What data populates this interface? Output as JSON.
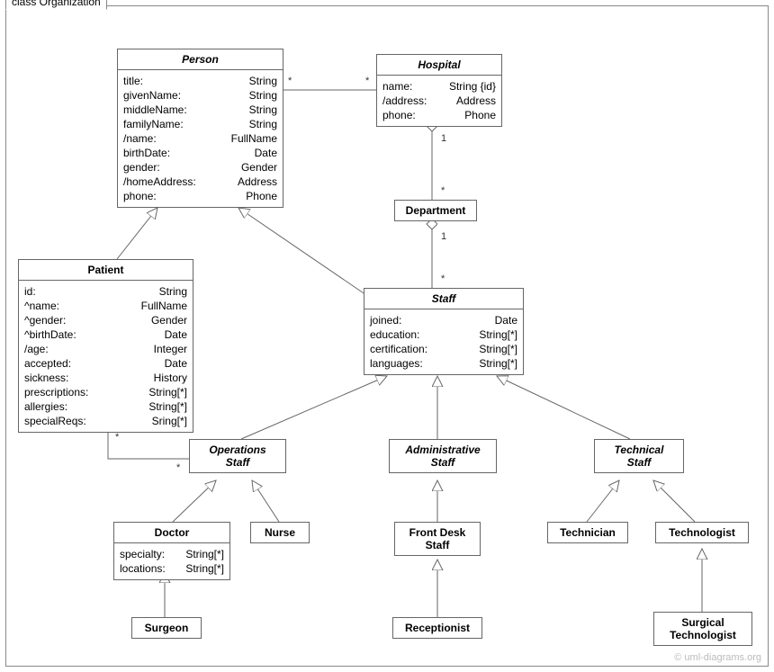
{
  "frameTitle": "class Organization",
  "watermark": "© uml-diagrams.org",
  "classes": {
    "person": {
      "name": "Person",
      "attrs": [
        {
          "k": "title:",
          "v": "String"
        },
        {
          "k": "givenName:",
          "v": "String"
        },
        {
          "k": "middleName:",
          "v": "String"
        },
        {
          "k": "familyName:",
          "v": "String"
        },
        {
          "k": "/name:",
          "v": "FullName"
        },
        {
          "k": "birthDate:",
          "v": "Date"
        },
        {
          "k": "gender:",
          "v": "Gender"
        },
        {
          "k": "/homeAddress:",
          "v": "Address"
        },
        {
          "k": "phone:",
          "v": "Phone"
        }
      ]
    },
    "hospital": {
      "name": "Hospital",
      "attrs": [
        {
          "k": "name:",
          "v": "String {id}"
        },
        {
          "k": "/address:",
          "v": "Address"
        },
        {
          "k": "phone:",
          "v": "Phone"
        }
      ]
    },
    "department": {
      "name": "Department"
    },
    "patient": {
      "name": "Patient",
      "attrs": [
        {
          "k": "id:",
          "v": "String"
        },
        {
          "k": "^name:",
          "v": "FullName"
        },
        {
          "k": "^gender:",
          "v": "Gender"
        },
        {
          "k": "^birthDate:",
          "v": "Date"
        },
        {
          "k": "/age:",
          "v": "Integer"
        },
        {
          "k": "accepted:",
          "v": "Date"
        },
        {
          "k": "sickness:",
          "v": "History"
        },
        {
          "k": "prescriptions:",
          "v": "String[*]"
        },
        {
          "k": "allergies:",
          "v": "String[*]"
        },
        {
          "k": "specialReqs:",
          "v": "Sring[*]"
        }
      ]
    },
    "staff": {
      "name": "Staff",
      "attrs": [
        {
          "k": "joined:",
          "v": "Date"
        },
        {
          "k": "education:",
          "v": "String[*]"
        },
        {
          "k": "certification:",
          "v": "String[*]"
        },
        {
          "k": "languages:",
          "v": "String[*]"
        }
      ]
    },
    "opsStaff": {
      "name": "Operations\nStaff"
    },
    "adminStaff": {
      "name": "Administrative\nStaff"
    },
    "techStaff": {
      "name": "Technical\nStaff"
    },
    "doctor": {
      "name": "Doctor",
      "attrs": [
        {
          "k": "specialty:",
          "v": "String[*]"
        },
        {
          "k": "locations:",
          "v": "String[*]"
        }
      ]
    },
    "nurse": {
      "name": "Nurse"
    },
    "frontDesk": {
      "name": "Front Desk\nStaff"
    },
    "technician": {
      "name": "Technician"
    },
    "technologist": {
      "name": "Technologist"
    },
    "surgeon": {
      "name": "Surgeon"
    },
    "receptionist": {
      "name": "Receptionist"
    },
    "surgTech": {
      "name": "Surgical\nTechnologist"
    }
  },
  "mult": {
    "personHospital_p": "*",
    "personHospital_h": "*",
    "hospDept_h": "1",
    "hospDept_d": "*",
    "deptStaff_d": "1",
    "deptStaff_s": "*",
    "patientOps_p": "*",
    "patientOps_o": "*"
  }
}
